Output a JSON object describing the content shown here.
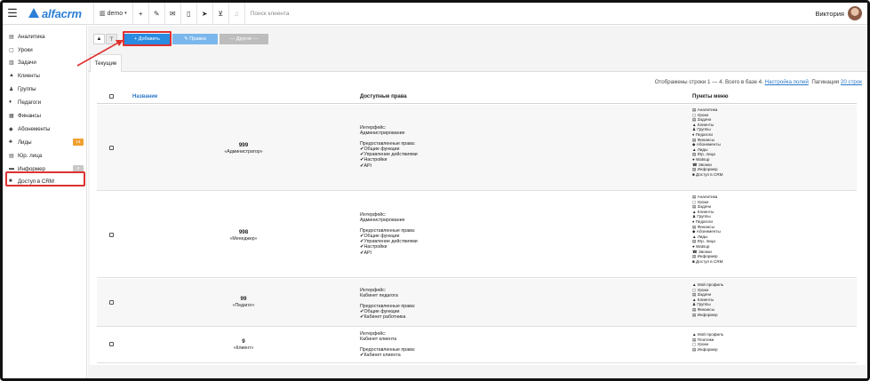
{
  "topbar": {
    "brand": "alfacrm",
    "branch": "demo",
    "search_placeholder": "Поиск клиента",
    "user_name": "Виктория"
  },
  "sidebar": {
    "items": [
      {
        "label": "Аналитика",
        "icon": "chart-icon"
      },
      {
        "label": "Уроки",
        "icon": "calendar-icon"
      },
      {
        "label": "Задачи",
        "icon": "tasks-icon"
      },
      {
        "label": "Клиенты",
        "icon": "user-icon"
      },
      {
        "label": "Группы",
        "icon": "group-icon"
      },
      {
        "label": "Педагоги",
        "icon": "teacher-icon"
      },
      {
        "label": "Финансы",
        "icon": "money-icon"
      },
      {
        "label": "Абонементы",
        "icon": "tag-icon"
      },
      {
        "label": "Лиды",
        "icon": "leads-icon",
        "badge": "14",
        "badge_color": "#f0a030"
      },
      {
        "label": "Юр. лица",
        "icon": "company-icon"
      },
      {
        "label": "Информер",
        "icon": "informer-icon",
        "badge": "0",
        "badge_color": "#c8c8c8"
      },
      {
        "label": "Доступ в CRM",
        "icon": "lock-icon"
      }
    ]
  },
  "toolbar": {
    "add_label": "+ Добавить",
    "edit_label": "✎ Правка",
    "other_label": "— Другое —"
  },
  "tabs": {
    "current": "Текущие"
  },
  "summary": {
    "text": "Отображены строки 1 — 4. Всего в базе 4.",
    "settings_link": "Настройка полей",
    "pagination_label": "Пагинация",
    "pagination_value": "20 строк"
  },
  "table": {
    "headers": {
      "name": "Название",
      "rights": "Доступные права",
      "menu": "Пункты меню"
    },
    "rows": [
      {
        "num": "999",
        "name": "«Администратор»",
        "interface_label": "Интерфейс:",
        "interface_value": "Администрирование",
        "rights_label": "Предоставленные права:",
        "rights": [
          "✔Общие функции",
          "✔Управление действиями",
          "✔Настройки",
          "✔API"
        ],
        "menu": [
          "▤ Аналитика",
          "▢ Уроки",
          "▤ Задачи",
          "▲ Клиенты",
          "♟ Группы",
          "♦ Педагоги",
          "▤ Финансы",
          "◆ Абонементы",
          "▲ Лиды",
          "▤ Юр. лица",
          "● Watsup",
          "☎ Звонки",
          "▤ Информер",
          "■ Доступ в CRM"
        ]
      },
      {
        "num": "998",
        "name": "«Менеджер»",
        "interface_label": "Интерфейс:",
        "interface_value": "Администрирование",
        "rights_label": "Предоставленные права:",
        "rights": [
          "✔Общие функции",
          "✔Управление действиями",
          "✔Настройки",
          "✔API"
        ],
        "menu": [
          "▤ Аналитика",
          "▢ Уроки",
          "▤ Задачи",
          "▲ Клиенты",
          "♟ Группы",
          "♦ Педагоги",
          "▤ Финансы",
          "◆ Абонементы",
          "▲ Лиды",
          "▤ Юр. лица",
          "● Watsup",
          "☎ Звонки",
          "▤ Информер",
          "■ Доступ в CRM"
        ]
      },
      {
        "num": "99",
        "name": "«Педагог»",
        "interface_label": "Интерфейс:",
        "interface_value": "Кабинет педагога",
        "rights_label": "Предоставленные права:",
        "rights": [
          "✔Общие функции",
          "✔Кабинет работника"
        ],
        "menu": [
          "▲ Мой профиль",
          "▢ Уроки",
          "▤ Задачи",
          "▲ Клиенты",
          "♟ Группы",
          "▤ Финансы",
          "▤ Информер"
        ]
      },
      {
        "num": "9",
        "name": "«Клиент»",
        "interface_label": "Интерфейс:",
        "interface_value": "Кабинет клиента",
        "rights_label": "Предоставленные права:",
        "rights": [
          "✔Кабинет клиента"
        ],
        "menu": [
          "▲ Мой профиль",
          "▤ Платежи",
          "▢ Уроки",
          "▤ Информер"
        ]
      }
    ]
  },
  "colors": {
    "accent": "#2a8be0",
    "highlight": "#e03030",
    "brand": "#2b7fd6"
  }
}
